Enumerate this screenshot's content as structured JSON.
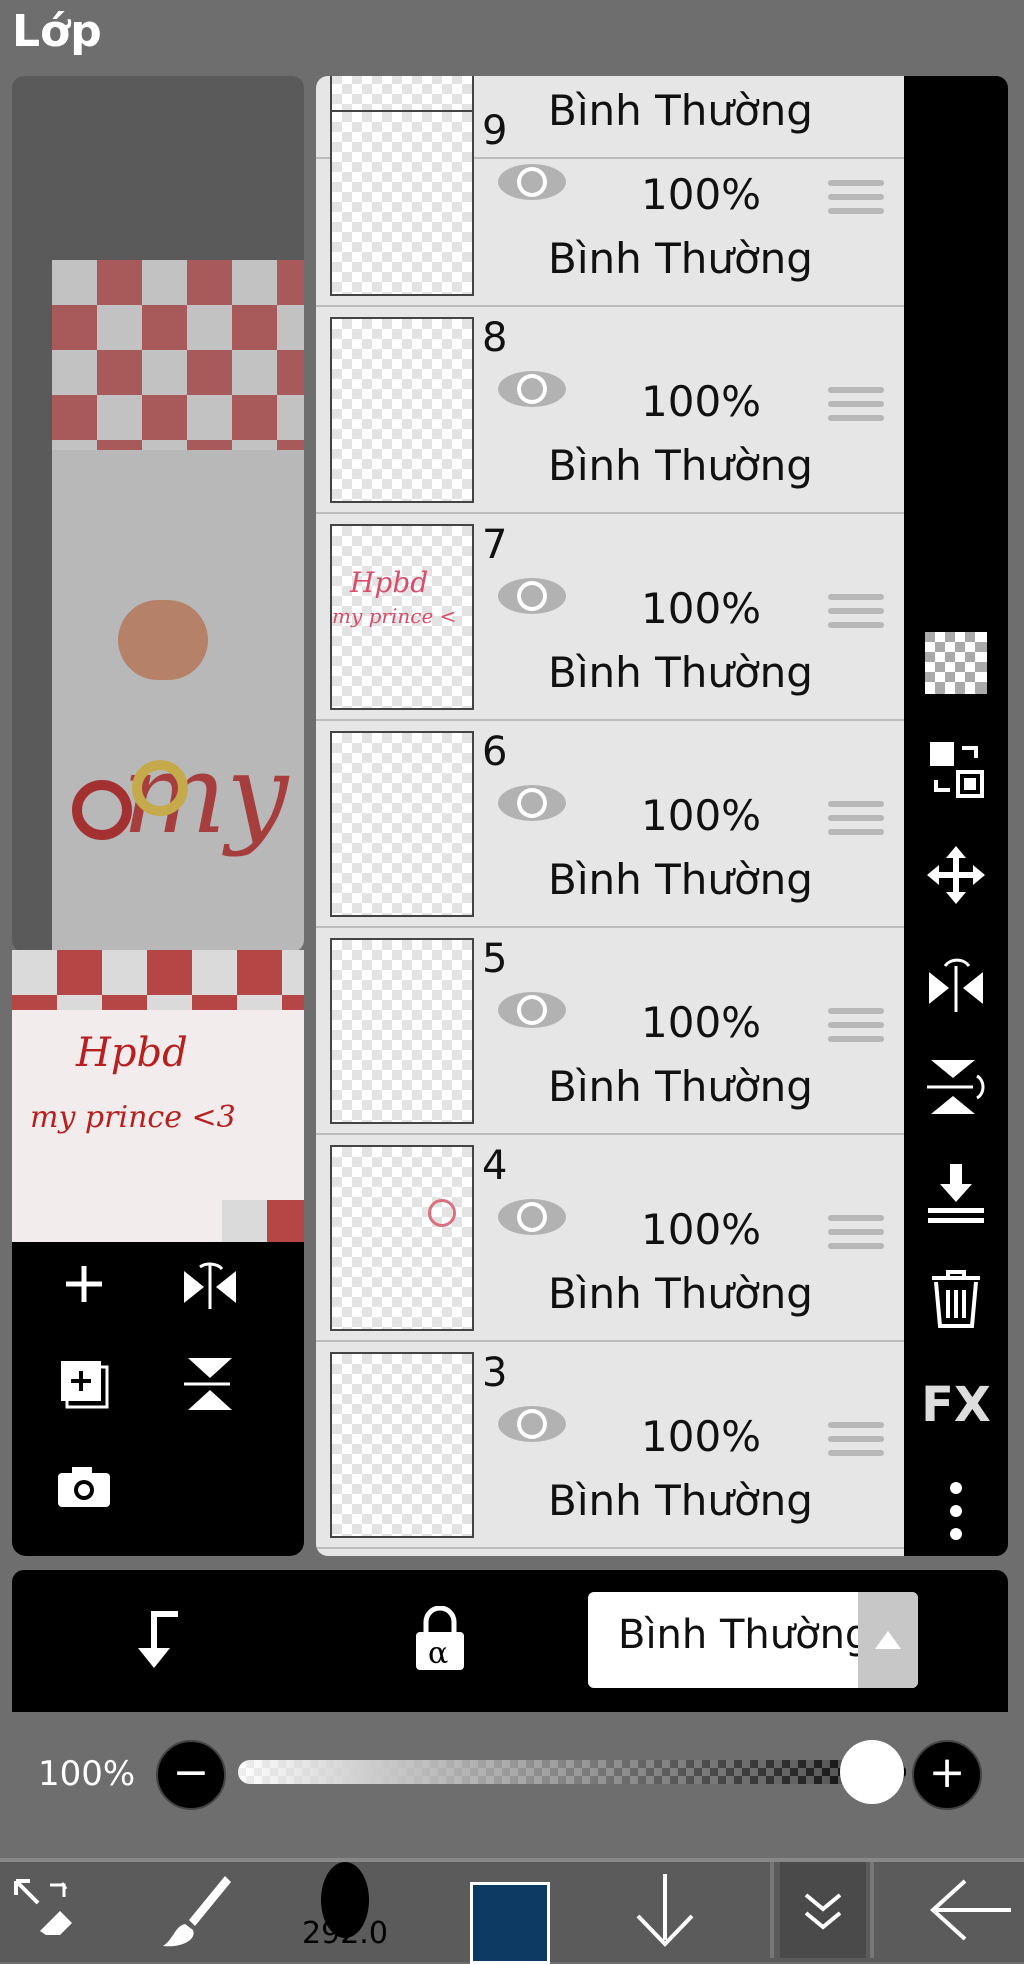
{
  "header": {
    "title": "Lớp"
  },
  "preview": {
    "canvas_text": "my",
    "thumb_line1": "Hpbd",
    "thumb_line2": "my prince <3"
  },
  "layers": [
    {
      "number": "9",
      "opacity": "100%",
      "blend": "Bình Thường",
      "visible": true
    },
    {
      "number": "8",
      "opacity": "100%",
      "blend": "Bình Thường",
      "visible": true
    },
    {
      "number": "7",
      "opacity": "100%",
      "blend": "Bình Thường",
      "visible": true,
      "thumb_text1": "Hpbd",
      "thumb_text2": "my prince <"
    },
    {
      "number": "6",
      "opacity": "100%",
      "blend": "Bình Thường",
      "visible": true
    },
    {
      "number": "5",
      "opacity": "100%",
      "blend": "Bình Thường",
      "visible": true
    },
    {
      "number": "4",
      "opacity": "100%",
      "blend": "Bình Thường",
      "visible": true
    },
    {
      "number": "3",
      "opacity": "100%",
      "blend": "Bình Thường",
      "visible": true
    }
  ],
  "partial_top_layer_blend": "Bình Thường",
  "right_tools": [
    "transparency-icon",
    "swap-layers-icon",
    "move-icon",
    "flip-horizontal-icon",
    "flip-vertical-icon",
    "merge-down-icon",
    "trash-icon",
    "fx-icon",
    "more-vert-icon"
  ],
  "right_tools_fx_label": "FX",
  "left_tools": [
    "add-layer-icon",
    "flip-horizontal-icon",
    "add-copy-layer-icon",
    "flip-vertical-icon",
    "camera-icon"
  ],
  "blend_bar": {
    "selected_blend": "Bình Thường",
    "alpha_label": "α"
  },
  "opacity": {
    "label": "100%",
    "value": 1.0,
    "minus": "−",
    "plus": "+"
  },
  "toolbar": {
    "brush_size": "292.0",
    "color": "#0d3a63"
  },
  "colors": {
    "accent_red": "#b82020",
    "panel_bg": "#6e6e6e",
    "row_bg": "#e6e6e6"
  }
}
